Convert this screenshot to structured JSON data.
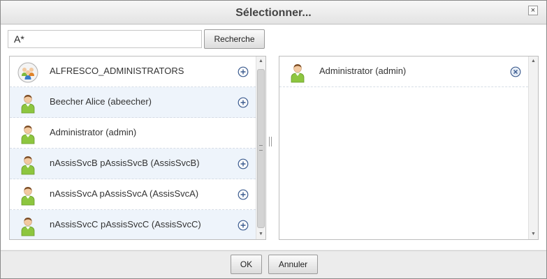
{
  "dialog": {
    "title": "Sélectionner...",
    "close_label": "×"
  },
  "search": {
    "value": "A*",
    "button_label": "Recherche"
  },
  "results": [
    {
      "label": "ALFRESCO_ADMINISTRATORS",
      "icon": "group-icon",
      "addable": true
    },
    {
      "label": "Beecher Alice (abeecher)",
      "icon": "user-icon",
      "addable": true
    },
    {
      "label": "Administrator (admin)",
      "icon": "user-icon",
      "addable": false
    },
    {
      "label": "nAssisSvcB pAssisSvcB (AssisSvcB)",
      "icon": "user-icon",
      "addable": true
    },
    {
      "label": "nAssisSvcA pAssisSvcA (AssisSvcA)",
      "icon": "user-icon",
      "addable": true
    },
    {
      "label": "nAssisSvcC pAssisSvcC (AssisSvcC)",
      "icon": "user-icon",
      "addable": true
    }
  ],
  "selected": [
    {
      "label": "Administrator (admin)",
      "icon": "user-icon"
    }
  ],
  "footer": {
    "ok_label": "OK",
    "cancel_label": "Annuler"
  },
  "colors": {
    "alt_row": "#eef4fb",
    "add_icon": "#3b5b8f",
    "user_body": "#8dc63f"
  }
}
